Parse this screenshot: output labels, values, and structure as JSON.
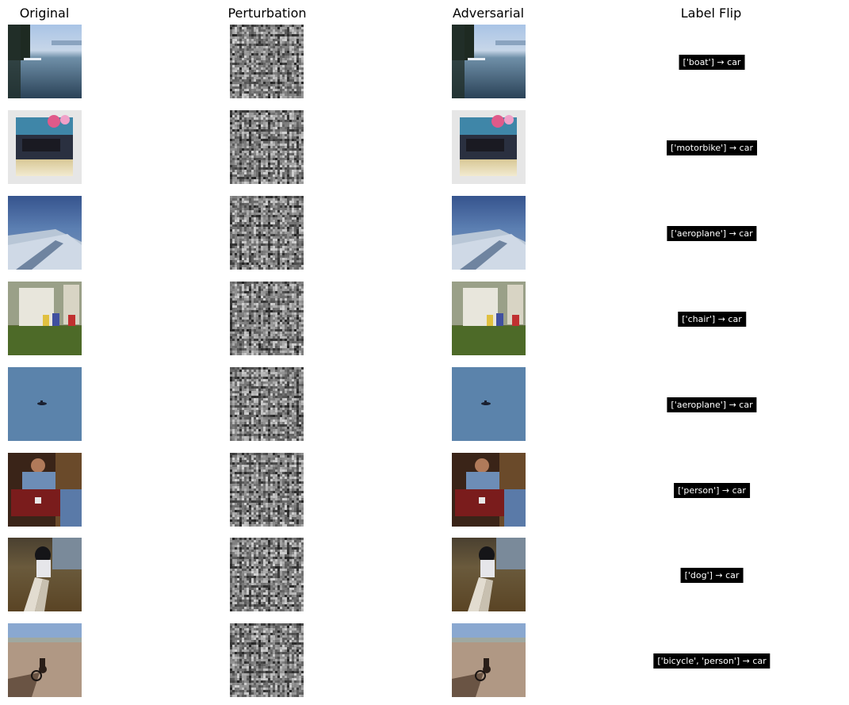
{
  "headers": {
    "original": "Original",
    "perturbation": "Perturbation",
    "adversarial": "Adversarial",
    "label_flip": "Label Flip"
  },
  "rows": [
    {
      "scene": "lake-boat",
      "label_flip": "['boat'] → car"
    },
    {
      "scene": "motorbike-poster",
      "label_flip": "['motorbike'] → car"
    },
    {
      "scene": "aeroplane-wing",
      "label_flip": "['aeroplane'] → car"
    },
    {
      "scene": "chairs-house",
      "label_flip": "['chair'] → car"
    },
    {
      "scene": "aeroplane-sky",
      "label_flip": "['aeroplane'] → car"
    },
    {
      "scene": "person-indoor",
      "label_flip": "['person'] → car"
    },
    {
      "scene": "dog-floor",
      "label_flip": "['dog'] → car"
    },
    {
      "scene": "bicycle-beach",
      "label_flip": "['bicycle', 'person'] → car"
    }
  ]
}
